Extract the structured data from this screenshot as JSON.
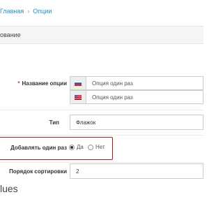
{
  "breadcrumb": {
    "items": [
      "Главная",
      "Опции"
    ],
    "separator": "›"
  },
  "section": {
    "title": "ование"
  },
  "form": {
    "option_name": {
      "label": "Название опции",
      "values": [
        "Опция один раз",
        "Опция один раз"
      ]
    },
    "type": {
      "label": "Тип",
      "value": "Флажок"
    },
    "add_once": {
      "label": "Добавлять один раз",
      "options": [
        "Да",
        "Нет"
      ],
      "selected": "Да"
    },
    "sort_order": {
      "label": "Порядок сортировки",
      "value": "2"
    }
  },
  "values_section": {
    "title": "lues"
  },
  "colors": {
    "link": "#1e91cf",
    "highlight_border": "#a11d1d",
    "required": "#dd3333"
  },
  "icons": [
    "russian-flag-icon",
    "english-flag-icon"
  ]
}
